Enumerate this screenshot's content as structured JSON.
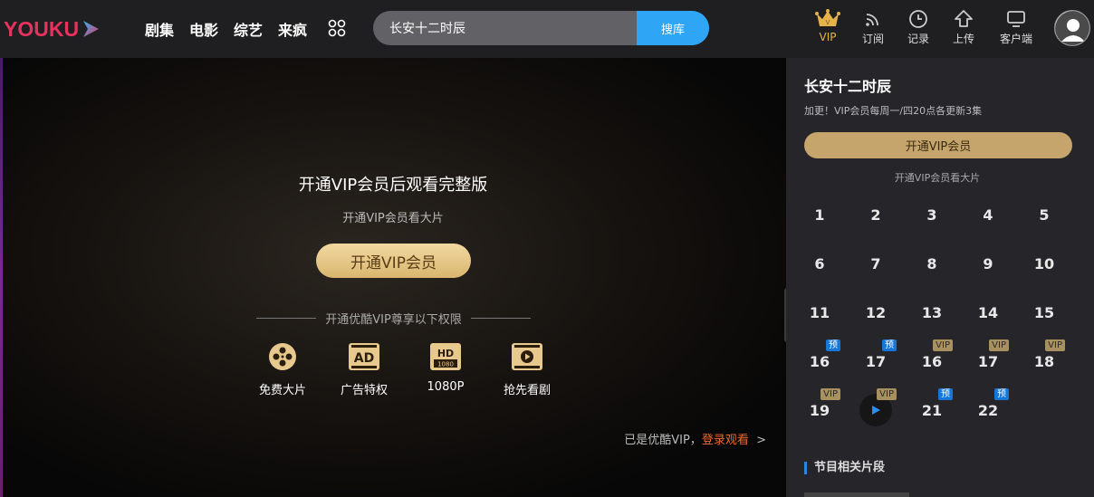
{
  "header": {
    "logo_text": "YOUKU",
    "nav": [
      "剧集",
      "电影",
      "综艺",
      "来疯"
    ],
    "search_value": "长安十二时辰",
    "search_button": "搜库",
    "tools": [
      {
        "label": "VIP",
        "icon": "crown-icon"
      },
      {
        "label": "订阅",
        "icon": "rss-icon"
      },
      {
        "label": "记录",
        "icon": "clock-icon"
      },
      {
        "label": "上传",
        "icon": "upload-icon"
      },
      {
        "label": "客户端",
        "icon": "monitor-icon"
      }
    ]
  },
  "player": {
    "title": "开通VIP会员后观看完整版",
    "subtitle": "开通VIP会员看大片",
    "open_button": "开通VIP会员",
    "privileges_header": "开通优酷VIP尊享以下权限",
    "privileges": [
      {
        "label": "免费大片",
        "icon": "film-reel-icon"
      },
      {
        "label": "广告特权",
        "icon": "ad-icon"
      },
      {
        "label": "1080P",
        "icon": "hd-1080-icon"
      },
      {
        "label": "抢先看剧",
        "icon": "play-early-icon"
      }
    ],
    "login_prefix": "已是优酷VIP，",
    "login_link": "登录观看",
    "login_arrow": ">"
  },
  "side": {
    "title": "长安十二时辰",
    "desc": "加更！VIP会员每周一/四20点各更新3集",
    "vip_button": "开通VIP会员",
    "vip_sub": "开通VIP会员看大片",
    "episodes": [
      {
        "label": "1",
        "badge": ""
      },
      {
        "label": "2",
        "badge": ""
      },
      {
        "label": "3",
        "badge": ""
      },
      {
        "label": "4",
        "badge": ""
      },
      {
        "label": "5",
        "badge": ""
      },
      {
        "label": "6",
        "badge": ""
      },
      {
        "label": "7",
        "badge": ""
      },
      {
        "label": "8",
        "badge": ""
      },
      {
        "label": "9",
        "badge": ""
      },
      {
        "label": "10",
        "badge": ""
      },
      {
        "label": "11",
        "badge": ""
      },
      {
        "label": "12",
        "badge": ""
      },
      {
        "label": "13",
        "badge": ""
      },
      {
        "label": "14",
        "badge": ""
      },
      {
        "label": "15",
        "badge": ""
      },
      {
        "label": "16",
        "badge": "预"
      },
      {
        "label": "17",
        "badge": "预"
      },
      {
        "label": "16",
        "badge": "VIP"
      },
      {
        "label": "17",
        "badge": "VIP"
      },
      {
        "label": "18",
        "badge": "VIP"
      },
      {
        "label": "19",
        "badge": "VIP"
      },
      {
        "label": "",
        "badge": "VIP",
        "playing": true
      },
      {
        "label": "21",
        "badge": "预"
      },
      {
        "label": "22",
        "badge": "预"
      }
    ],
    "related_title": "节目相关片段"
  },
  "colors": {
    "search_button": "#2fa5f5",
    "vip_gold": "#d9b66f",
    "login_link": "#f06a2a",
    "badge_vip": "#a9905f",
    "badge_preview": "#1677d8"
  }
}
